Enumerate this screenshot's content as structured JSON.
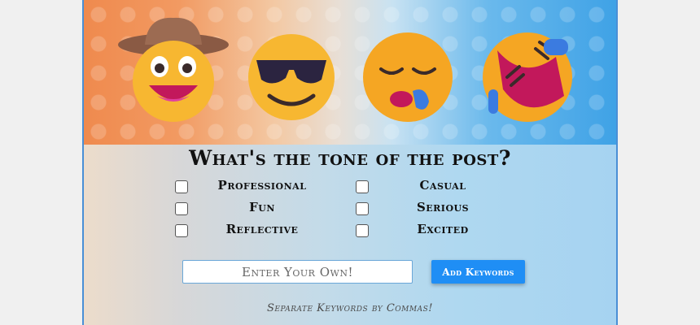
{
  "banner": {
    "emojis": [
      "cowboy-hat-face-icon",
      "smiling-face-with-sunglasses-icon",
      "sleeping-face-icon",
      "rolling-on-the-floor-laughing-icon"
    ],
    "colors": {
      "left": "#ef8a4e",
      "right": "#3fa2e6"
    }
  },
  "title": "What's the tone of the post?",
  "options": [
    {
      "label": "Professional",
      "checked": false
    },
    {
      "label": "Casual",
      "checked": false
    },
    {
      "label": "Fun",
      "checked": false
    },
    {
      "label": "Serious",
      "checked": false
    },
    {
      "label": "Reflective",
      "checked": false
    },
    {
      "label": "Excited",
      "checked": false
    }
  ],
  "keywords": {
    "placeholder": "Enter Your Own!",
    "value": "",
    "button_label": "Add Keywords",
    "hint": "Separate Keywords by Commas!"
  },
  "colors": {
    "accent": "#1f8ef5",
    "border": "#4a8fd6"
  }
}
